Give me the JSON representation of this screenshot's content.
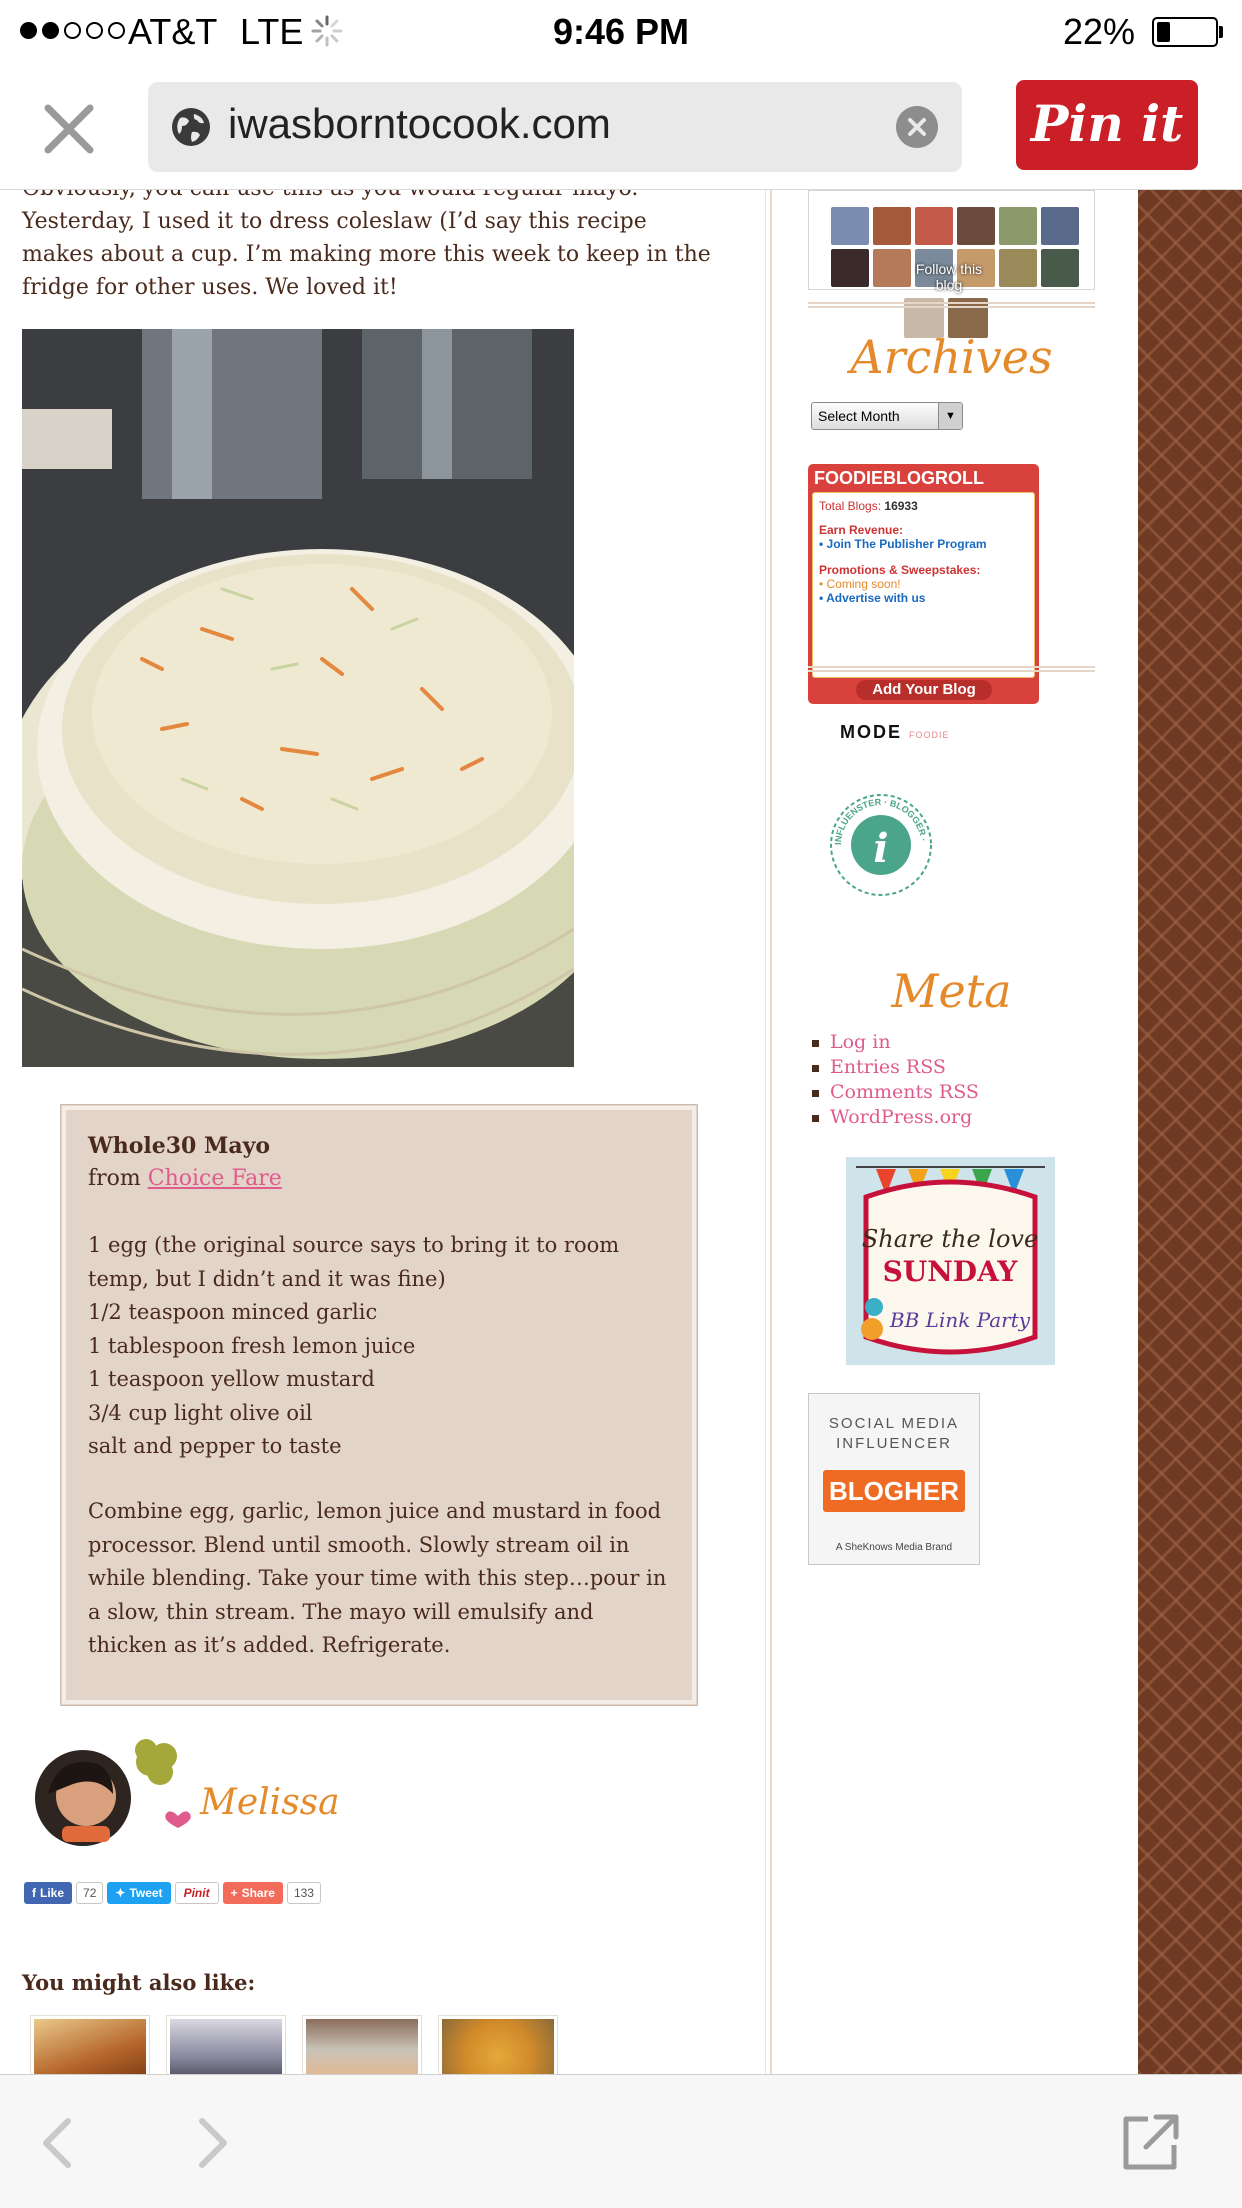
{
  "status": {
    "carrier": "AT&T",
    "network": "LTE",
    "time": "9:46 PM",
    "battery_pct": "22%",
    "battery_level": 0.22
  },
  "browser": {
    "url": "iwasborntocook.com",
    "pin_label": "Pin it"
  },
  "post": {
    "intro": "Obviously, you can use this as you would regular mayo. Yesterday, I used it to dress coleslaw (I’d say this recipe makes about a cup. I’m making more this week to keep in the fridge for other uses. We loved it!",
    "photo_icon": "coleslaw-photo"
  },
  "recipe": {
    "title": "Whole30 Mayo",
    "from_prefix": "from ",
    "from_link": "Choice Fare",
    "ingredients": [
      "1 egg (the original source says to bring it to room temp, but I didn’t and it was fine)",
      "1/2 teaspoon minced garlic",
      "1 tablespoon fresh lemon juice",
      "1 teaspoon yellow mustard",
      "3/4 cup light olive oil",
      "salt and pepper to taste"
    ],
    "directions": "Combine egg, garlic, lemon juice and mustard in food processor. Blend until smooth. Slowly stream oil in while blending. Take your time with this step…pour in a slow, thin stream. The mayo will emulsify and thicken as it’s added. Refrigerate."
  },
  "signature": {
    "name": "Melissa"
  },
  "share": {
    "like_label": "Like",
    "like_count": "72",
    "tweet_label": "Tweet",
    "pin_label": "Pinit",
    "share_label": "Share",
    "share_count": "133"
  },
  "related": {
    "heading": "You might also like:"
  },
  "sidebar": {
    "follow_text": "Follow this blog",
    "archives_title": "Archives",
    "archives_select": "Select Month",
    "foodie": {
      "header": "FOODIEBLOGROLL",
      "total_label": "Total Blogs:",
      "total_value": "16933",
      "earn_label": "Earn Revenue:",
      "earn_link": "Join The Publisher Program",
      "promo_label": "Promotions & Sweepstakes:",
      "promo_item": "Coming soon!",
      "advertise_link": "Advertise with us",
      "add_button": "Add Your Blog"
    },
    "mode_logo": "MODE",
    "mode_sub": "FOODIE",
    "ibn_text": "INFLUENSTER · BLOGGER · NETWORK",
    "meta_title": "Meta",
    "meta_links": [
      "Log in",
      "Entries RSS",
      "Comments RSS",
      "WordPress.org"
    ],
    "share_love": {
      "line1": "Share the love",
      "line2": "SUNDAY",
      "line3": "BB Link Party"
    },
    "blogher": {
      "top1": "SOCIAL MEDIA",
      "top2": "INFLUENCER",
      "brand": "BLOGHER",
      "footer": "A SheKnows Media Brand"
    }
  },
  "colors": {
    "accent_pink": "#e05b8d",
    "accent_orange": "#e58a2a",
    "text_brown": "#4a2a1c",
    "recipe_bg": "#e2d4c8",
    "pinterest_red": "#cb1f27"
  }
}
